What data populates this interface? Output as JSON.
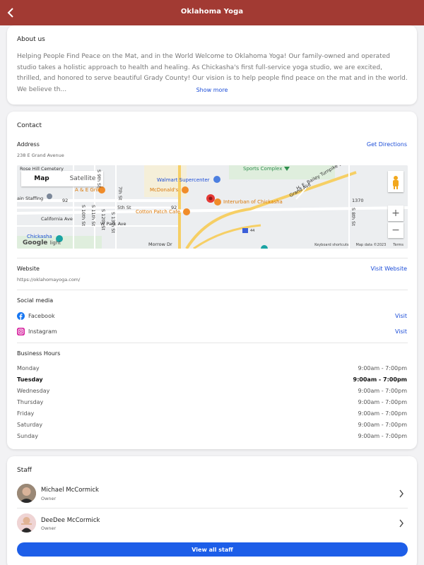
{
  "header": {
    "title": "Oklahoma Yoga",
    "back_icon": "chevron-left-icon"
  },
  "about": {
    "title": "About us",
    "text": "Helping People Find Peace on the Mat, and in the World Welcome to Oklahoma Yoga! Our family-owned and operated studio takes a holistic approach to health and healing. As Chickasha's first full-service yoga studio, we are excited, thrilled, and honored to serve beautiful Grady County! Our vision is to help people find peace on the mat and in the world. We believe th...",
    "show_more": "Show more"
  },
  "contact": {
    "title": "Contact",
    "address_label": "Address",
    "address_value": "238 E Grand Avenue",
    "directions": "Get Directions",
    "map": {
      "tab_map": "Map",
      "tab_satellite": "Satellite",
      "labels": {
        "sports_complex": "Sports Complex",
        "walmart": "Walmart Supercenter",
        "mcdonalds": "McDonald's",
        "ae_grill": "A & E Grill",
        "cotton_patch": "Cotton Patch Cafe",
        "interurban": "Interurban of Chickasha",
        "chickasha": "Chickasha",
        "rose_hill": "Rose Hill Cemetery",
        "staffing": "ain Staffing",
        "fifth_st": "5th St",
        "california": "California Ave",
        "park_ave": "W Park Ave",
        "morrow": "Morrow Dr",
        "turnpike": "H. E. Bailey Turnpike (Toll)",
        "grand_ave": "Grand Ave",
        "s9th": "S 9th St",
        "s8th": "S 8th St",
        "s7th": "7th St",
        "s10th": "S 10th St",
        "s11th": "S 11th St",
        "s12th": "S 12th St",
        "s13th": "S 13th St",
        "route92a": "92",
        "route92b": "92",
        "toll1370": "1370",
        "interstate": "44",
        "google": "Google",
        "light": "light"
      },
      "footer": {
        "shortcuts": "Keyboard shortcuts",
        "map_data": "Map data ©2023",
        "terms": "Terms"
      },
      "zoom_in": "+",
      "zoom_out": "−"
    },
    "website_label": "Website",
    "website_url": "https://oklahomayoga.com/",
    "visit_website": "Visit Website",
    "social_label": "Social media",
    "social": [
      {
        "name": "Facebook",
        "icon": "facebook-icon",
        "action": "Visit",
        "color": "#1877f2"
      },
      {
        "name": "Instagram",
        "icon": "instagram-icon",
        "action": "Visit",
        "color": "#d6249f"
      }
    ],
    "hours_label": "Business Hours",
    "hours": [
      {
        "day": "Monday",
        "time": "9:00am - 7:00pm"
      },
      {
        "day": "Tuesday",
        "time": "9:00am - 7:00pm"
      },
      {
        "day": "Wednesday",
        "time": "9:00am - 7:00pm"
      },
      {
        "day": "Thursday",
        "time": "9:00am - 7:00pm"
      },
      {
        "day": "Friday",
        "time": "9:00am - 7:00pm"
      },
      {
        "day": "Saturday",
        "time": "9:00am - 7:00pm"
      },
      {
        "day": "Sunday",
        "time": "9:00am - 7:00pm"
      }
    ]
  },
  "staff": {
    "title": "Staff",
    "members": [
      {
        "name": "Michael McCormick",
        "role": "Owner"
      },
      {
        "name": "DeeDee McCormick",
        "role": "Owner"
      }
    ],
    "view_all": "View all staff"
  },
  "colors": {
    "brand": "#a23a33",
    "link": "#1d4ed8",
    "button": "#1d5ee8"
  }
}
